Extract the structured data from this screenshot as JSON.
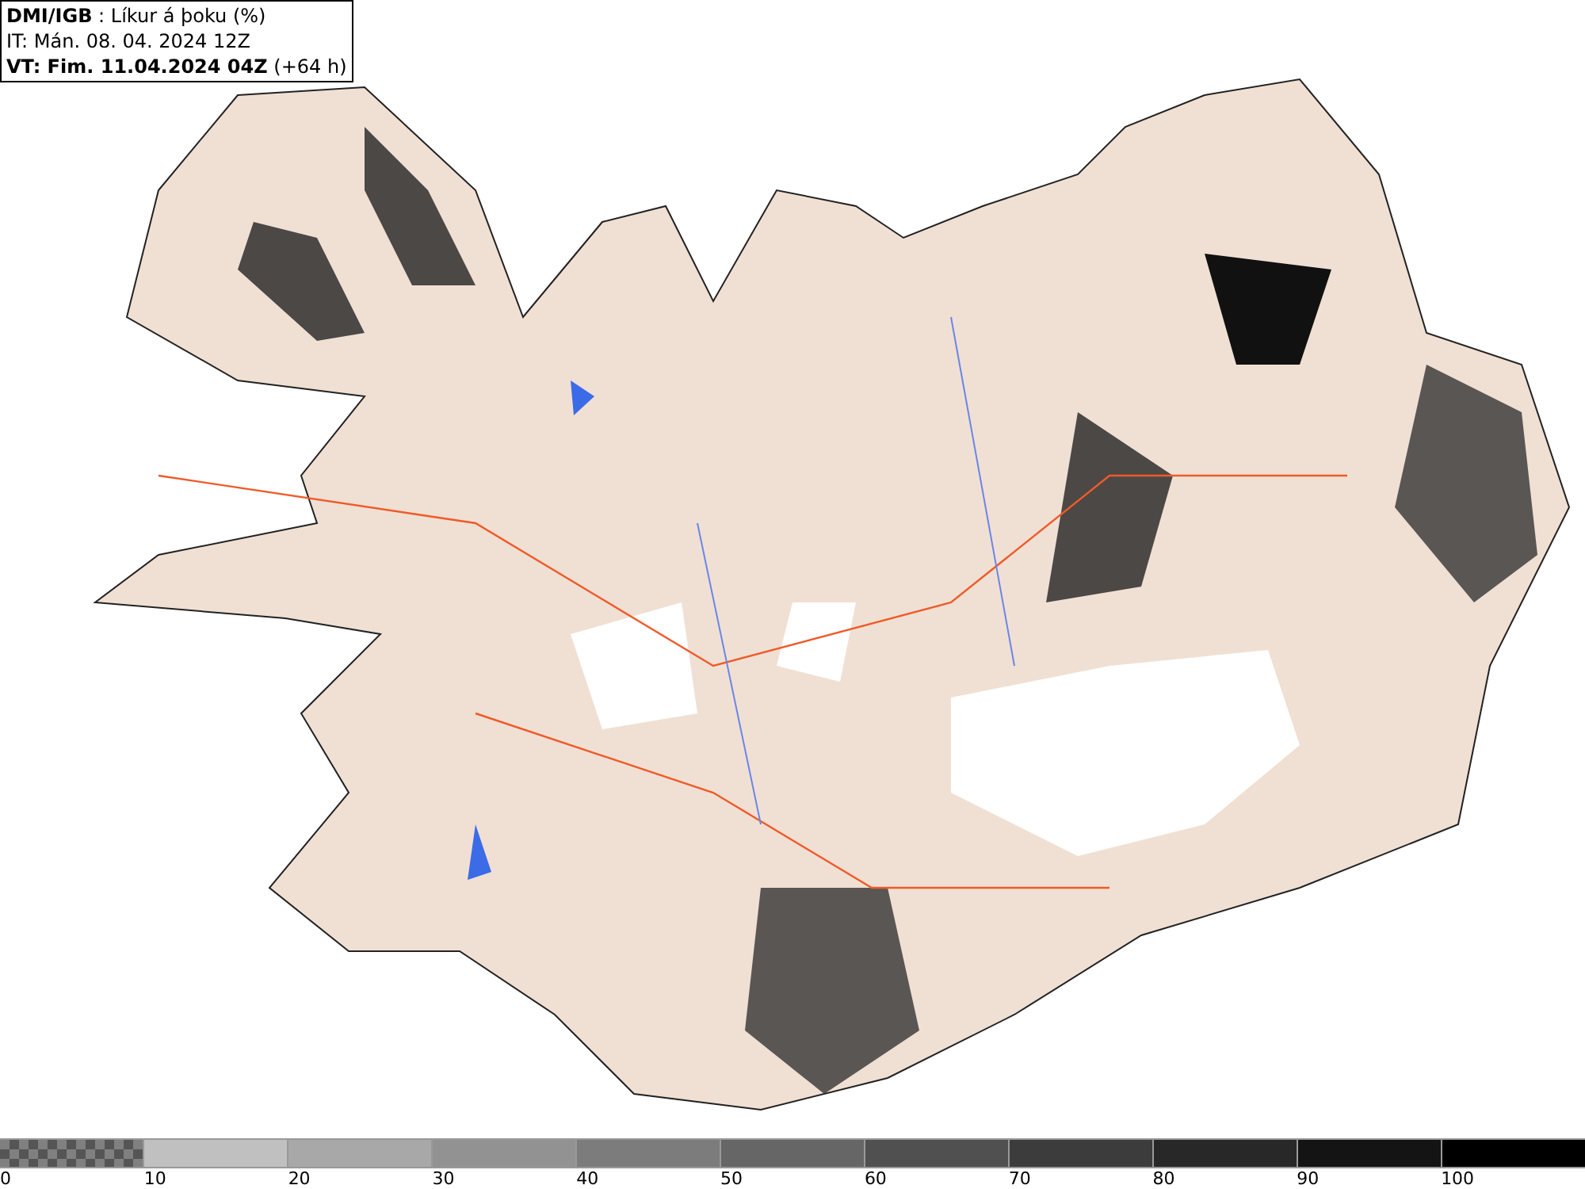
{
  "header": {
    "lines": [
      "**DMI/IGB** : Líkur á þoku (%)",
      "IT: Mán. 08. 04. 2024 12Z",
      "**VT: Fim. 11.04.2024 04Z** (+64 h)"
    ]
  },
  "legend": {
    "segments": [
      {
        "kind": "checker",
        "label": "0",
        "color": "#808080"
      },
      {
        "kind": "solid",
        "label": "10",
        "color": "#c0c0c0"
      },
      {
        "kind": "solid",
        "label": "20",
        "color": "#a8a8a8"
      },
      {
        "kind": "solid",
        "label": "30",
        "color": "#929292"
      },
      {
        "kind": "solid",
        "label": "40",
        "color": "#7c7c7c"
      },
      {
        "kind": "solid",
        "label": "50",
        "color": "#666666"
      },
      {
        "kind": "solid",
        "label": "60",
        "color": "#505050"
      },
      {
        "kind": "solid",
        "label": "70",
        "color": "#3c3c3c"
      },
      {
        "kind": "solid",
        "label": "80",
        "color": "#282828"
      },
      {
        "kind": "solid",
        "label": "90",
        "color": "#141414"
      },
      {
        "kind": "solid",
        "label": "100",
        "color": "#000000"
      }
    ]
  }
}
